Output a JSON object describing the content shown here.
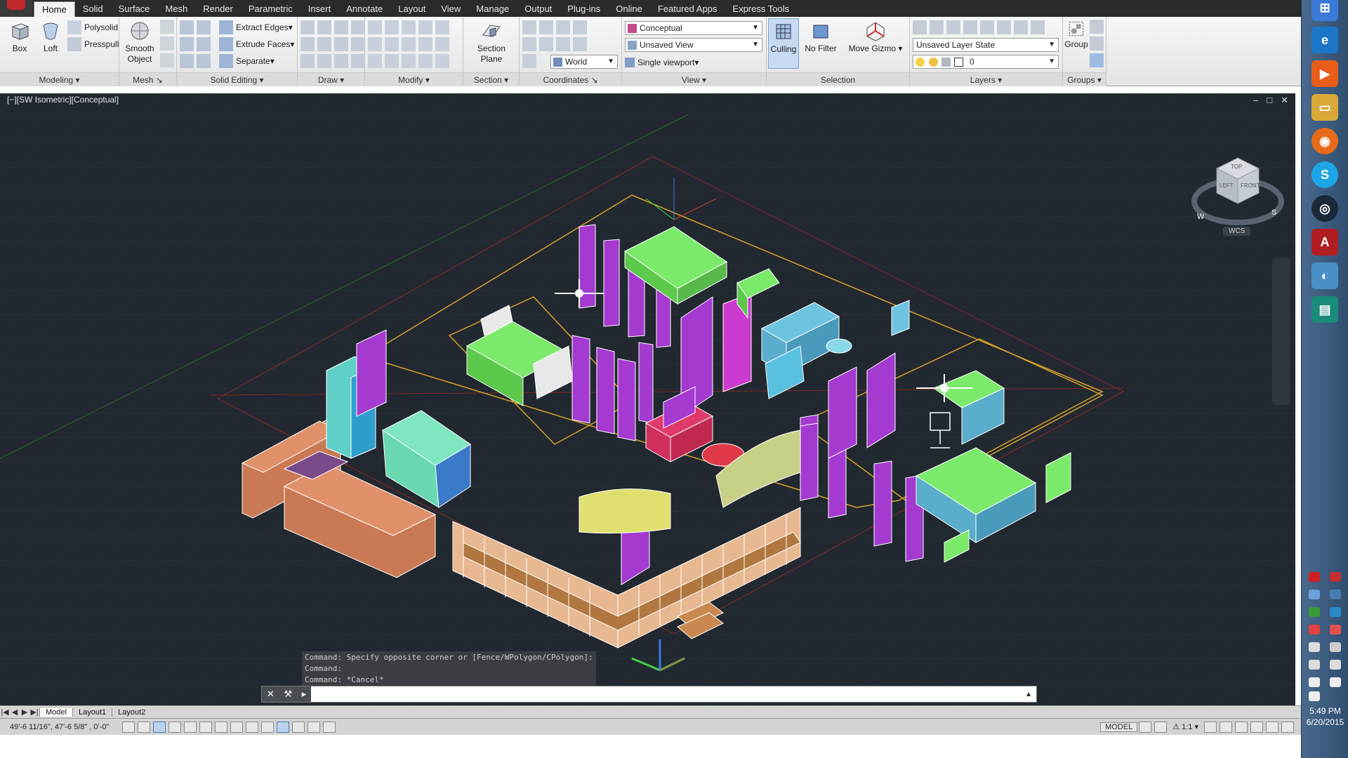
{
  "ribbon": {
    "tabs": [
      "Home",
      "Solid",
      "Surface",
      "Mesh",
      "Render",
      "Parametric",
      "Insert",
      "Annotate",
      "Layout",
      "View",
      "Manage",
      "Output",
      "Plug-ins",
      "Online",
      "Featured Apps",
      "Express Tools"
    ],
    "active_tab": "Home",
    "modeling": {
      "box": "Box",
      "loft": "Loft",
      "polysolid": "Polysolid",
      "presspull": "Presspull",
      "title": "Modeling"
    },
    "mesh": {
      "smooth_object": "Smooth Object",
      "title": "Mesh"
    },
    "solid_editing": {
      "extract_edges": "Extract Edges",
      "extrude_faces": "Extrude Faces",
      "separate": "Separate",
      "title": "Solid Editing"
    },
    "draw": {
      "title": "Draw"
    },
    "modify": {
      "title": "Modify"
    },
    "section": {
      "section_plane": "Section Plane",
      "title": "Section"
    },
    "coordinates": {
      "world": "World",
      "title": "Coordinates"
    },
    "view": {
      "visual_style": "Conceptual",
      "named_view": "Unsaved View",
      "viewport": "Single viewport",
      "title": "View"
    },
    "selection": {
      "culling": "Culling",
      "no_filter": "No Filter",
      "move_gizmo": "Move Gizmo",
      "title": "Selection"
    },
    "layers": {
      "layer_state": "Unsaved Layer State",
      "current_layer": "0",
      "title": "Layers"
    },
    "groups": {
      "group": "Group",
      "title": "Groups"
    }
  },
  "viewport": {
    "label": "[−][SW Isometric][Conceptual]",
    "controls": [
      "–",
      "□",
      "✕"
    ],
    "viewcube": {
      "top": "TOP",
      "left": "LEFT",
      "front": "FRONT",
      "compass": [
        "W",
        "S"
      ]
    },
    "wcs": "WCS"
  },
  "command": {
    "history": [
      "Command: Specify opposite corner or [Fence/WPolygon/CPolygon]:",
      "Command:",
      "Command: *Cancel*"
    ],
    "placeholder": ""
  },
  "layout_tabs": [
    "Model",
    "Layout1",
    "Layout2"
  ],
  "status": {
    "coords": "49'-6 11/16\", 47'-6 5/8\" , 0'-0\"",
    "model": "MODEL",
    "scale": "1:1"
  },
  "taskbar": {
    "time": "5:49 PM",
    "date": "6/20/2015"
  },
  "colors": {
    "viewport_bg": "#212830",
    "accent": "#c0272d",
    "ribbon_bg": "#e8e8e8"
  }
}
